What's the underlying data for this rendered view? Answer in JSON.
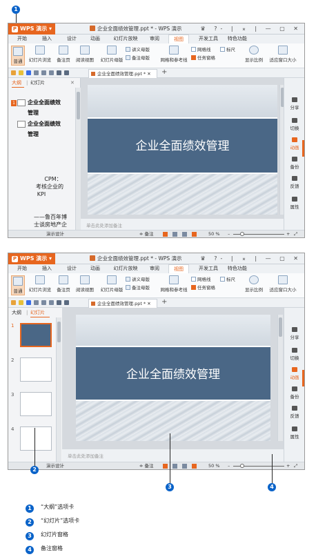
{
  "callouts": {
    "one": "1",
    "two": "2",
    "three": "3",
    "four": "4"
  },
  "app": {
    "wps_button": "WPS 演示",
    "doc_title": "企业全面绩效管理.ppt * - WPS 演示",
    "window_controls": "♛ ?- | ⌅ | — ▢ ✕"
  },
  "menu": [
    "开始",
    "插入",
    "设计",
    "动画",
    "幻灯片放映",
    "审阅",
    "视图",
    "开发工具",
    "特色功能"
  ],
  "ribbon": {
    "normal": "普通",
    "slideshow_browse": "幻灯片浏览",
    "notes_page": "备注页",
    "reading_view": "阅读视图",
    "slide_master": "幻灯片母版",
    "handout_master": "讲义母版",
    "notes_master": "备注母版",
    "grid_guides": "网格和参考线",
    "gridlines": "网格线",
    "ruler": "标尺",
    "task_pane": "任务窗格",
    "zoom": "显示比例",
    "fit_window": "适应窗口大小"
  },
  "doc_tab": "企业全面绩效管理.ppt *",
  "panel_tabs": {
    "outline": "大纲",
    "slides": "幻灯片"
  },
  "outline": {
    "items": [
      {
        "num": "1",
        "text": "企业全面绩效"
      },
      {
        "num": "",
        "text": "管理"
      },
      {
        "num": "",
        "text": "企业全面绩效"
      },
      {
        "num": "",
        "text": "管理"
      }
    ],
    "plain": [
      "CPM：",
      "考核企业的",
      "KPI",
      "——鲁百年博",
      "士谈房地产企"
    ]
  },
  "slide_title": "企业全面绩效管理",
  "notes_placeholder": "单击此处添加备注",
  "right_bar": [
    "分享",
    "切换",
    "动画",
    "备份",
    "反馈",
    "属性"
  ],
  "status": {
    "design": "演示设计",
    "notes": "备注",
    "zoom": "50 %"
  },
  "thumb_numbers": [
    "1",
    "2",
    "3",
    "4"
  ],
  "legend": [
    {
      "num": "1",
      "text": "“大纲”选项卡"
    },
    {
      "num": "2",
      "text": "“幻灯片”选项卡"
    },
    {
      "num": "3",
      "text": "幻灯片窗格"
    },
    {
      "num": "4",
      "text": "备注窗格"
    }
  ],
  "colors": {
    "accent": "#e7661f",
    "slide_blue": "#4a6786",
    "callout": "#0a63c9"
  }
}
